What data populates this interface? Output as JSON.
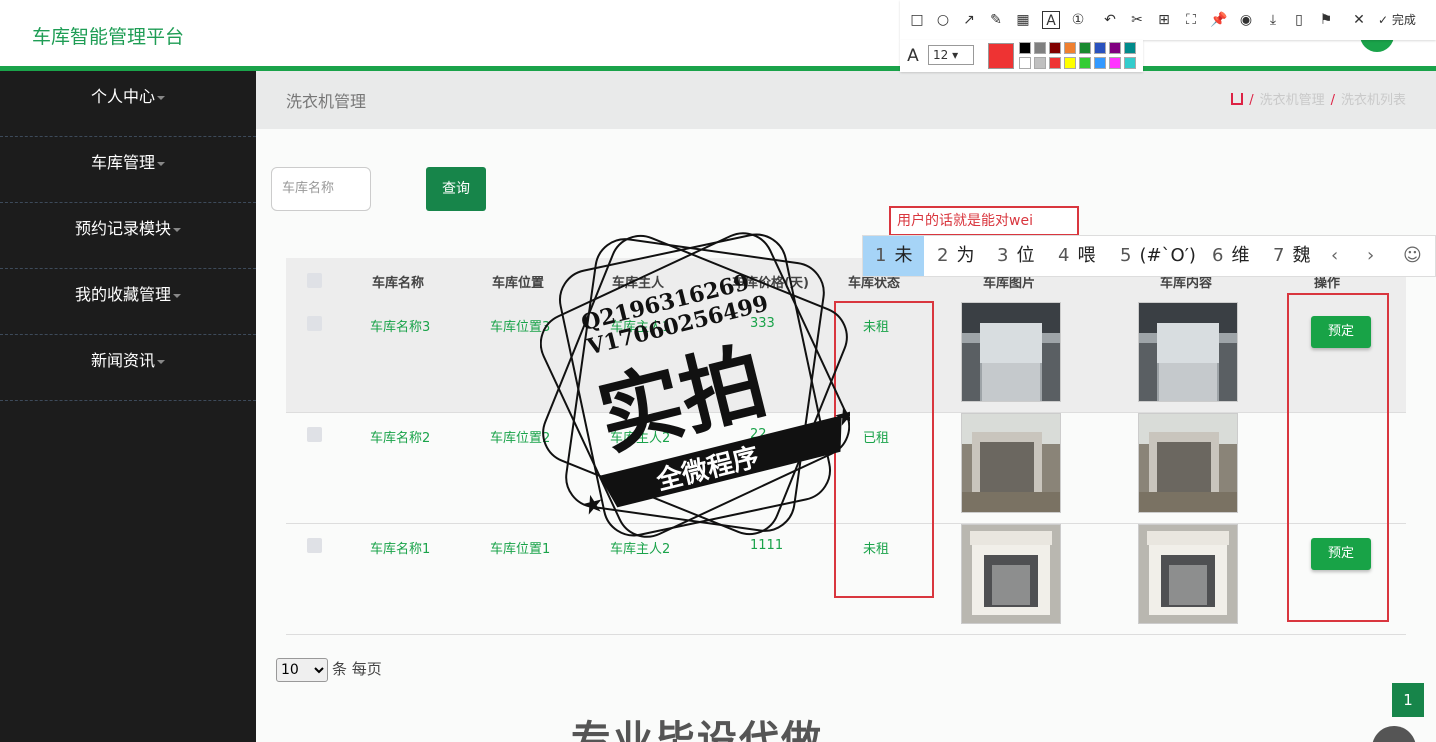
{
  "app_title": "车库智能管理平台",
  "sidebar": {
    "items": [
      {
        "label": "个人中心"
      },
      {
        "label": "车库管理"
      },
      {
        "label": "预约记录模块"
      },
      {
        "label": "我的收藏管理"
      },
      {
        "label": "新闻资讯"
      }
    ]
  },
  "page": {
    "title": "洗衣机管理",
    "breadcrumb": [
      "洗衣机管理",
      "洗衣机列表"
    ]
  },
  "search": {
    "placeholder": "车库名称",
    "button": "查询"
  },
  "table": {
    "headers": [
      "车库名称",
      "车库位置",
      "车库主人",
      "车库价格(天)",
      "车库状态",
      "车库图片",
      "车库内容",
      "操作"
    ],
    "rows": [
      {
        "name": "车库名称3",
        "location": "车库位置3",
        "owner": "车库主人1",
        "price": "333",
        "status": "未租",
        "action": "预定"
      },
      {
        "name": "车库名称2",
        "location": "车库位置2",
        "owner": "车库主人2",
        "price": "22",
        "status": "已租",
        "action": ""
      },
      {
        "name": "车库名称1",
        "location": "车库位置1",
        "owner": "车库主人2",
        "price": "1111",
        "status": "未租",
        "action": "预定"
      }
    ]
  },
  "pagination": {
    "page_size": "10",
    "page_size_suffix": "条 每页",
    "current_page": "1"
  },
  "bottom_text": "专业毕设代做",
  "screenshot_tool": {
    "done_label": "完成",
    "font_size": "12",
    "colors": [
      "#000000",
      "#808080",
      "#800000",
      "#f08030",
      "#1a8a30",
      "#2a52be",
      "#800080",
      "#008b8b",
      "#ffffff",
      "#c0c0c0",
      "#ee3333",
      "#ffff00",
      "#33cc33",
      "#3399ff",
      "#ff33ff",
      "#33cccc"
    ],
    "current_color": "#ee3333"
  },
  "annotation_text": "用户的话就是能对wei",
  "ime": {
    "candidates": [
      {
        "num": "1",
        "text": "未"
      },
      {
        "num": "2",
        "text": "为"
      },
      {
        "num": "3",
        "text": "位"
      },
      {
        "num": "4",
        "text": "喂"
      },
      {
        "num": "5",
        "text": "(#`O′)"
      },
      {
        "num": "6",
        "text": "维"
      },
      {
        "num": "7",
        "text": "魏"
      }
    ]
  },
  "watermark": {
    "qq": "Q2196316269",
    "vx": "V17060256499",
    "main": "实拍",
    "sub": "全微程序"
  },
  "accent_color": "#1aa34a"
}
